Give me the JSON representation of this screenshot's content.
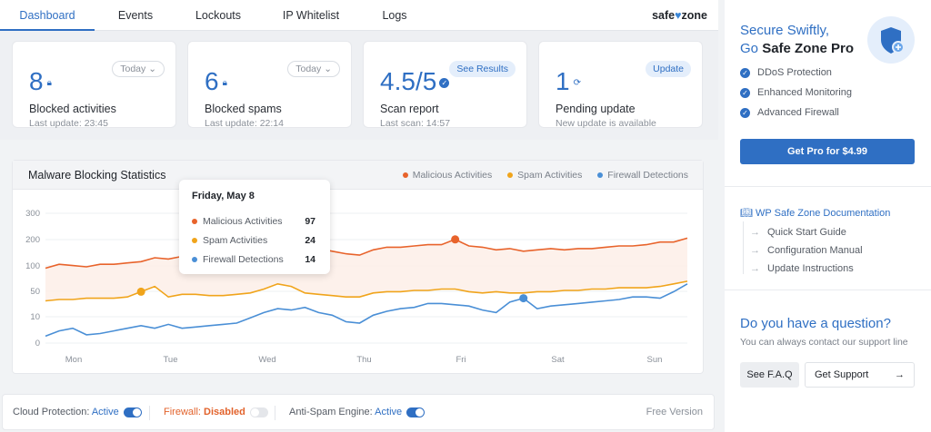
{
  "nav": {
    "tabs": [
      {
        "label": "Dashboard"
      },
      {
        "label": "Events"
      },
      {
        "label": "Lockouts"
      },
      {
        "label": "IP Whitelist"
      },
      {
        "label": "Logs"
      }
    ],
    "brand_left": "safe",
    "brand_right": "zone"
  },
  "cards": [
    {
      "value": "8",
      "label": "Blocked activities",
      "sub": "Last update: 23:45",
      "control": "Today",
      "icon": "lock-icon"
    },
    {
      "value": "6",
      "label": "Blocked spams",
      "sub": "Last update: 22:14",
      "control": "Today",
      "icon": "lock-icon"
    },
    {
      "value": "4.5",
      "value_total": "/5",
      "label": "Scan report",
      "sub": "Last scan: 14:57",
      "control": "See Results",
      "icon": "check-icon"
    },
    {
      "value": "1",
      "label": "Pending update",
      "sub": "New update is available",
      "control": "Update",
      "icon": "refresh-icon"
    }
  ],
  "chart": {
    "title": "Malware Blocking Statistics",
    "legend": [
      {
        "name": "Malicious Activities",
        "color": "#e8632b"
      },
      {
        "name": "Spam Activities",
        "color": "#f0a41b"
      },
      {
        "name": "Firewall Detections",
        "color": "#4a8fd6"
      }
    ],
    "tooltip": {
      "title": "Friday, May 8",
      "rows": [
        {
          "name": "Malicious Activities",
          "value": "97",
          "color": "#e8632b"
        },
        {
          "name": "Spam Activities",
          "value": "24",
          "color": "#f0a41b"
        },
        {
          "name": "Firewall Detections",
          "value": "14",
          "color": "#4a8fd6"
        }
      ]
    }
  },
  "chart_data": {
    "type": "line",
    "y_ticks": [
      "300",
      "200",
      "100",
      "50",
      "10",
      "0"
    ],
    "x_labels": [
      "Mon",
      "Tue",
      "Wed",
      "Thu",
      "Fri",
      "Sat",
      "Sun"
    ],
    "series": [
      {
        "name": "Malicious Activities",
        "color": "#e8632b",
        "values": [
          2.9,
          3.05,
          3.0,
          2.95,
          3.05,
          3.05,
          3.1,
          3.15,
          3.3,
          3.25,
          3.35,
          3.4,
          3.35,
          3.4,
          3.5,
          3.55,
          3.6,
          3.6,
          3.55,
          3.6,
          3.65,
          3.55,
          3.45,
          3.4,
          3.6,
          3.7,
          3.7,
          3.75,
          3.8,
          3.8,
          4.0,
          3.75,
          3.7,
          3.6,
          3.65,
          3.55,
          3.6,
          3.65,
          3.6,
          3.65,
          3.65,
          3.7,
          3.75,
          3.75,
          3.8,
          3.9,
          3.9,
          4.05
        ]
      },
      {
        "name": "Spam Activities",
        "color": "#f0a41b",
        "values": [
          1.65,
          1.7,
          1.7,
          1.75,
          1.75,
          1.75,
          1.8,
          2.0,
          2.2,
          1.8,
          1.9,
          1.9,
          1.85,
          1.85,
          1.9,
          1.95,
          2.1,
          2.3,
          2.2,
          1.95,
          1.9,
          1.85,
          1.8,
          1.8,
          1.95,
          2.0,
          2.0,
          2.05,
          2.05,
          2.1,
          2.1,
          2.0,
          1.95,
          2.0,
          1.95,
          1.95,
          2.0,
          2.0,
          2.05,
          2.05,
          2.1,
          2.1,
          2.15,
          2.15,
          2.15,
          2.2,
          2.3,
          2.4
        ]
      },
      {
        "name": "Firewall Detections",
        "color": "#4a8fd6",
        "values": [
          0.3,
          0.5,
          0.6,
          0.35,
          0.4,
          0.5,
          0.6,
          0.7,
          0.6,
          0.75,
          0.6,
          0.65,
          0.7,
          0.75,
          0.8,
          1.0,
          1.2,
          1.35,
          1.3,
          1.4,
          1.2,
          1.1,
          0.85,
          0.8,
          1.1,
          1.25,
          1.35,
          1.4,
          1.55,
          1.55,
          1.5,
          1.45,
          1.3,
          1.2,
          1.6,
          1.75,
          1.35,
          1.45,
          1.5,
          1.55,
          1.6,
          1.65,
          1.7,
          1.8,
          1.8,
          1.75,
          2.0,
          2.3
        ]
      }
    ],
    "highlights": [
      {
        "series": 1,
        "index": 7
      },
      {
        "series": 0,
        "index": 30
      },
      {
        "series": 2,
        "index": 35
      }
    ],
    "ylim": [
      0,
      5
    ]
  },
  "footer": {
    "items": [
      {
        "label": "Cloud Protection:",
        "status": "Active",
        "on": true
      },
      {
        "label": "Firewall:",
        "status": "Disabled",
        "on": false
      },
      {
        "label": "Anti-Spam Engine:",
        "status": "Active",
        "on": true
      }
    ],
    "version": "Free Version"
  },
  "sidebar": {
    "pro_line1": "Secure Swiftly,",
    "pro_line2a": "Go ",
    "pro_line2b": "Safe Zone Pro",
    "features": [
      "DDoS Protection",
      "Enhanced Monitoring",
      "Advanced Firewall"
    ],
    "get_pro": "Get Pro for $4.99",
    "doc_title": "WP Safe Zone Documentation",
    "doc_links": [
      "Quick Start Guide",
      "Configuration Manual",
      "Update Instructions"
    ],
    "question": "Do you have a question?",
    "question_sub": "You can always contact our support line",
    "faq": "See F.A.Q",
    "support": "Get Support"
  }
}
